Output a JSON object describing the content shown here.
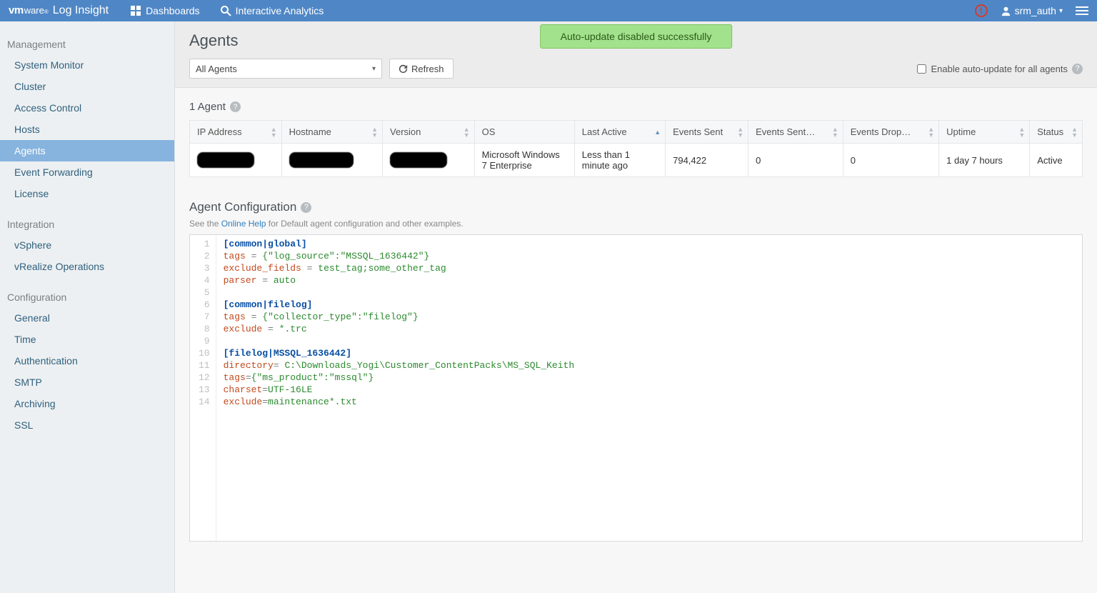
{
  "brand": {
    "vm": "vm",
    "ware": "ware",
    "li": "Log Insight"
  },
  "nav": {
    "dashboards": "Dashboards",
    "analytics": "Interactive Analytics"
  },
  "user": {
    "name": "srm_auth"
  },
  "toast": "Auto-update disabled successfully",
  "page_title": "Agents",
  "dropdown_value": "All Agents",
  "refresh_label": "Refresh",
  "auto_update_label": "Enable auto-update for all agents",
  "sidebar": {
    "management": {
      "title": "Management",
      "items": [
        "System Monitor",
        "Cluster",
        "Access Control",
        "Hosts",
        "Agents",
        "Event Forwarding",
        "License"
      ]
    },
    "integration": {
      "title": "Integration",
      "items": [
        "vSphere",
        "vRealize Operations"
      ]
    },
    "configuration": {
      "title": "Configuration",
      "items": [
        "General",
        "Time",
        "Authentication",
        "SMTP",
        "Archiving",
        "SSL"
      ]
    }
  },
  "count_label": "1 Agent",
  "columns": [
    "IP Address",
    "Hostname",
    "Version",
    "OS",
    "Last Active",
    "Events Sent",
    "Events Sent…",
    "Events Drop…",
    "Uptime",
    "Status"
  ],
  "row": {
    "os": "Microsoft Windows 7 Enterprise",
    "last_active": "Less than 1 minute ago",
    "events_sent": "794,422",
    "events_sent2": "0",
    "events_drop": "0",
    "uptime": "1 day 7 hours",
    "status": "Active"
  },
  "agent_cfg_title": "Agent Configuration",
  "agent_cfg_sub_pre": "See the ",
  "agent_cfg_link": "Online Help",
  "agent_cfg_sub_post": " for Default agent configuration and other examples.",
  "code": {
    "l1_sec": "[common|global]",
    "l2_k": "tags",
    "l2_v": "{\"log_source\":\"MSSQL_1636442\"}",
    "l3_k": "exclude_fields",
    "l3_v": "test_tag;some_other_tag",
    "l4_k": "parser",
    "l4_v": "auto",
    "l6_sec": "[common|filelog]",
    "l7_k": "tags",
    "l7_v": "{\"collector_type\":\"filelog\"}",
    "l8_k": "exclude",
    "l8_v": "*.trc",
    "l10_sec": "[filelog|MSSQL_1636442]",
    "l11_k": "directory",
    "l11_v": "C:\\Downloads_Yogi\\Customer_ContentPacks\\MS_SQL_Keith",
    "l12_k": "tags",
    "l12_v": "{\"ms_product\":\"mssql\"}",
    "l13_k": "charset",
    "l13_v": "UTF-16LE",
    "l14_k": "exclude",
    "l14_v": "maintenance*.txt"
  }
}
